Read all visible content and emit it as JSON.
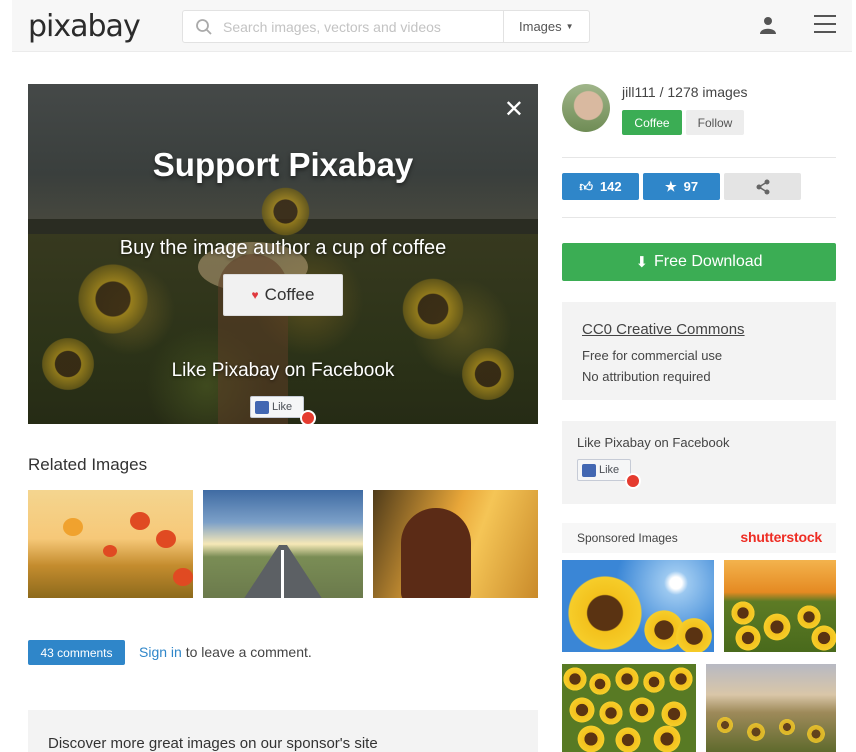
{
  "header": {
    "logo": "pixabay",
    "search_placeholder": "Search images, vectors and videos",
    "search_type": "Images"
  },
  "hero": {
    "title": "Support Pixabay",
    "subtitle": "Buy the image author a cup of coffee",
    "coffee_label": "Coffee",
    "facebook_text": "Like Pixabay on Facebook",
    "like_label": "Like"
  },
  "related": {
    "title": "Related Images"
  },
  "comments": {
    "count_label": "43 comments",
    "signin_link": "Sign in",
    "signin_rest": " to leave a comment."
  },
  "sponsor_bar": {
    "text": "Discover more great images on our sponsor's site"
  },
  "author": {
    "line": "jill111 / 1278 images",
    "coffee_label": "Coffee",
    "follow_label": "Follow"
  },
  "stats": {
    "likes": "142",
    "favorites": "97"
  },
  "download": {
    "label": "Free Download"
  },
  "license": {
    "title": "CC0 Creative Commons",
    "line1": "Free for commercial use",
    "line2": "No attribution required"
  },
  "facebook_box": {
    "title": "Like Pixabay on Facebook",
    "like_label": "Like"
  },
  "sponsored": {
    "label": "Sponsored Images",
    "brand": "shutterstock"
  },
  "colors": {
    "green": "#3bad54",
    "blue": "#2f86c9",
    "shutterstock_red": "#ee2d24"
  }
}
